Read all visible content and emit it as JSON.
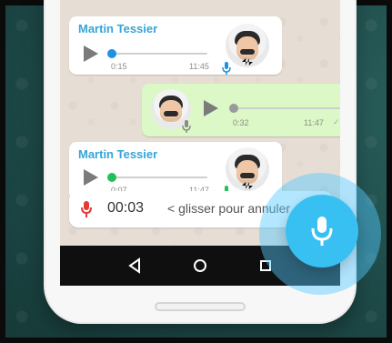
{
  "messages": [
    {
      "sender": "Martin Tessier",
      "elapsed": "0:15",
      "time": "11:45",
      "dot_color": "#1b93e5"
    },
    {
      "elapsed": "0:32",
      "time": "11:47",
      "checkmarks": "✓✓",
      "dot_color": "#9a9a9a"
    },
    {
      "sender": "Martin Tessier",
      "elapsed": "0:07",
      "time": "11:47",
      "dot_color": "#21c15a"
    }
  ],
  "recording": {
    "timer": "00:03",
    "slide_hint": "< glisser pour annuler"
  },
  "navbar": {
    "back_icon": "back-triangle-icon",
    "home_icon": "home-circle-icon",
    "recents_icon": "recents-square-icon"
  },
  "colors": {
    "sender": "#35a5d8",
    "fab": "#39c0f3",
    "record_mic": "#e53935"
  }
}
